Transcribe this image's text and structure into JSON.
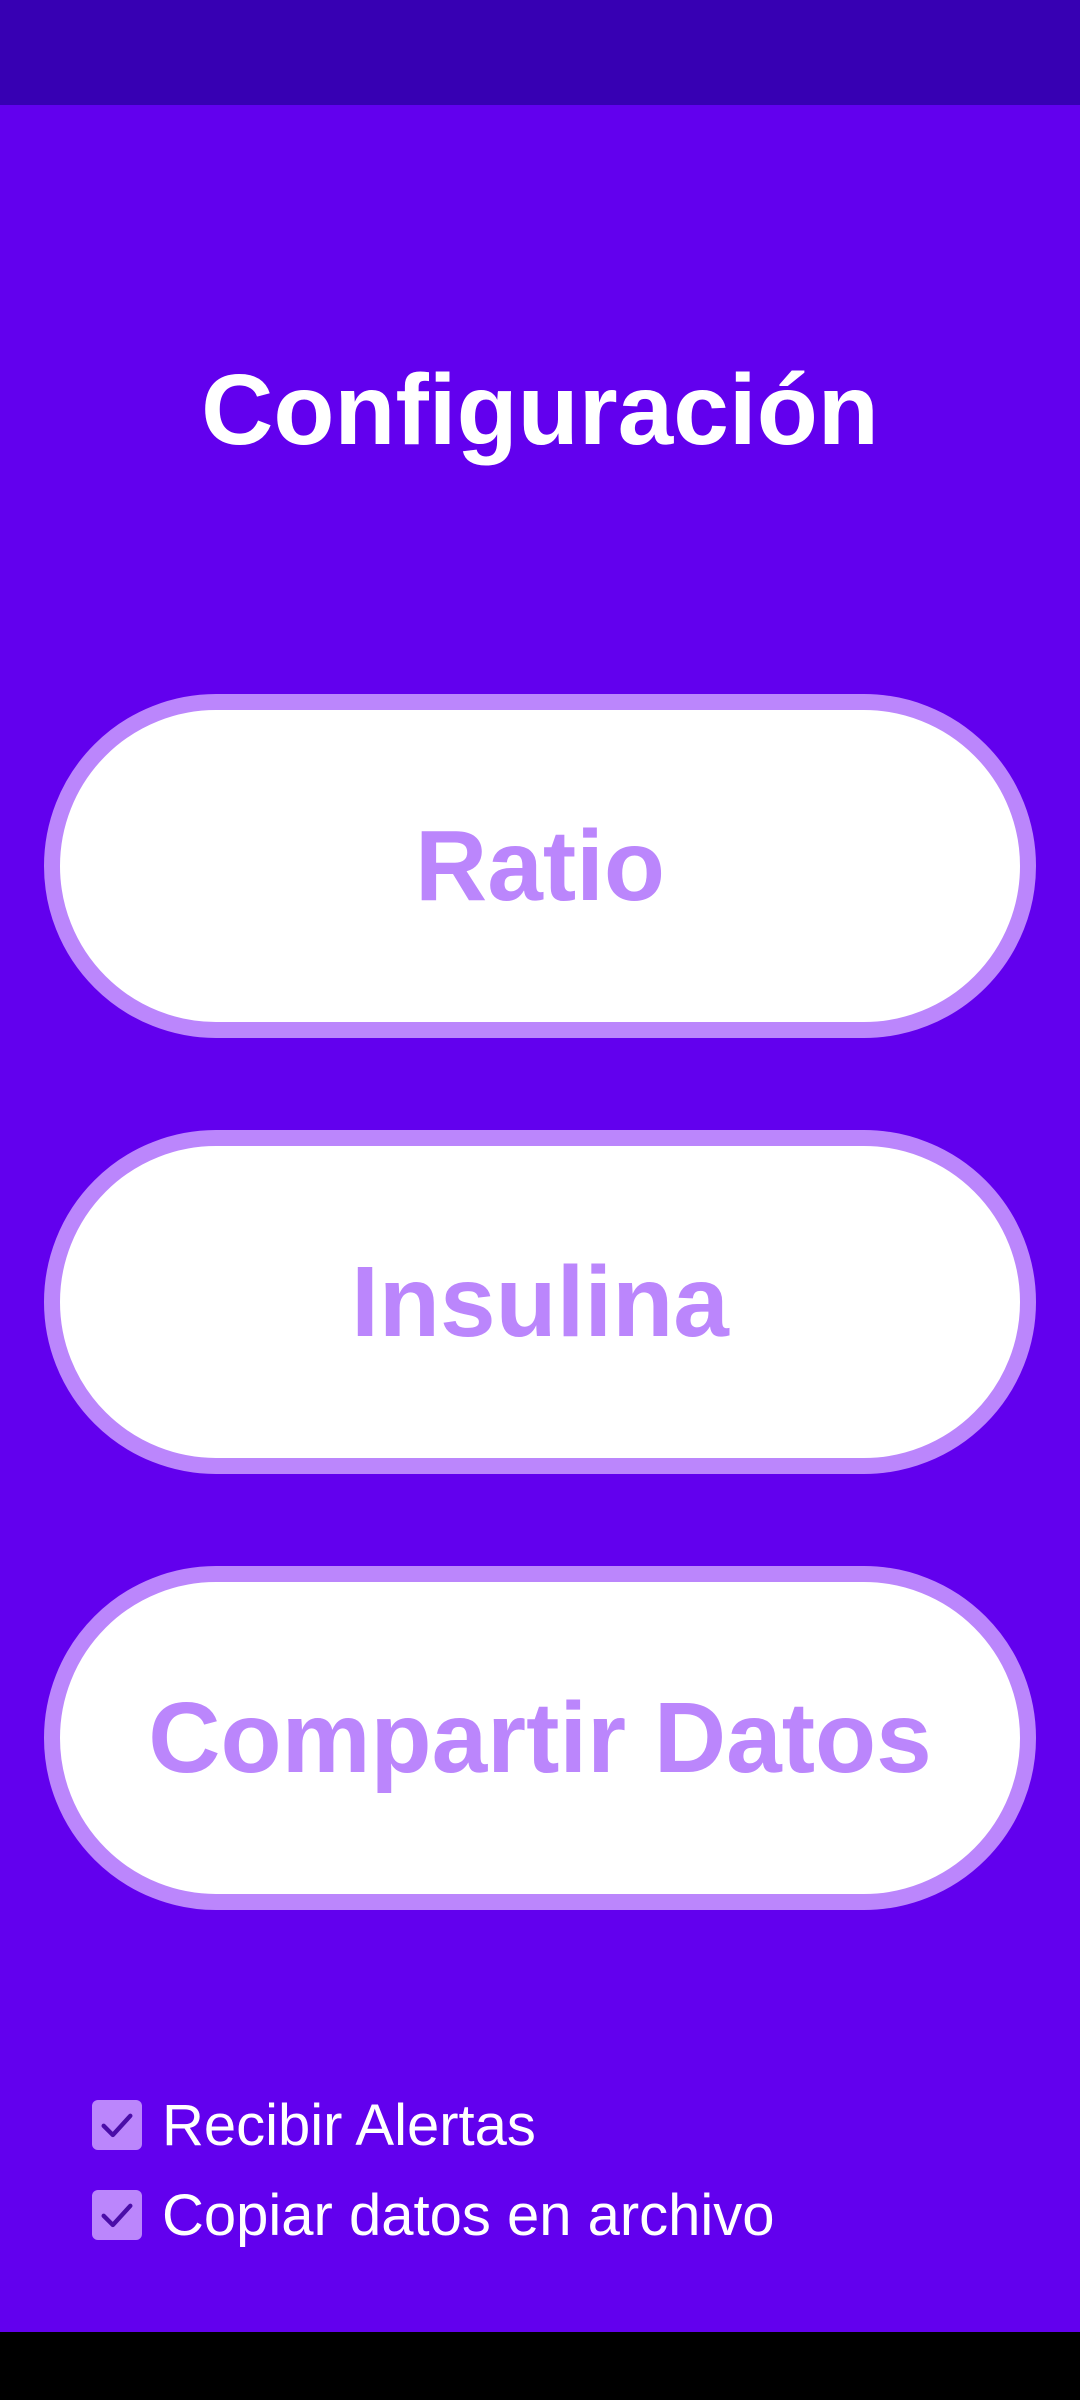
{
  "colors": {
    "primary": "#6200EE",
    "primary_dark": "#3700B3",
    "accent": "#BB86FC",
    "button_fill": "#FFFFFF",
    "text_light": "#FFFFFF"
  },
  "header": {
    "title": "Configuración"
  },
  "buttons": {
    "ratio": "Ratio",
    "insulina": "Insulina",
    "compartir": "Compartir Datos"
  },
  "options": {
    "alertas": {
      "label": "Recibir Alertas",
      "checked": true
    },
    "copiar": {
      "label": "Copiar datos en archivo",
      "checked": true
    }
  },
  "icons": {
    "checkbox_checked": "check-icon"
  }
}
